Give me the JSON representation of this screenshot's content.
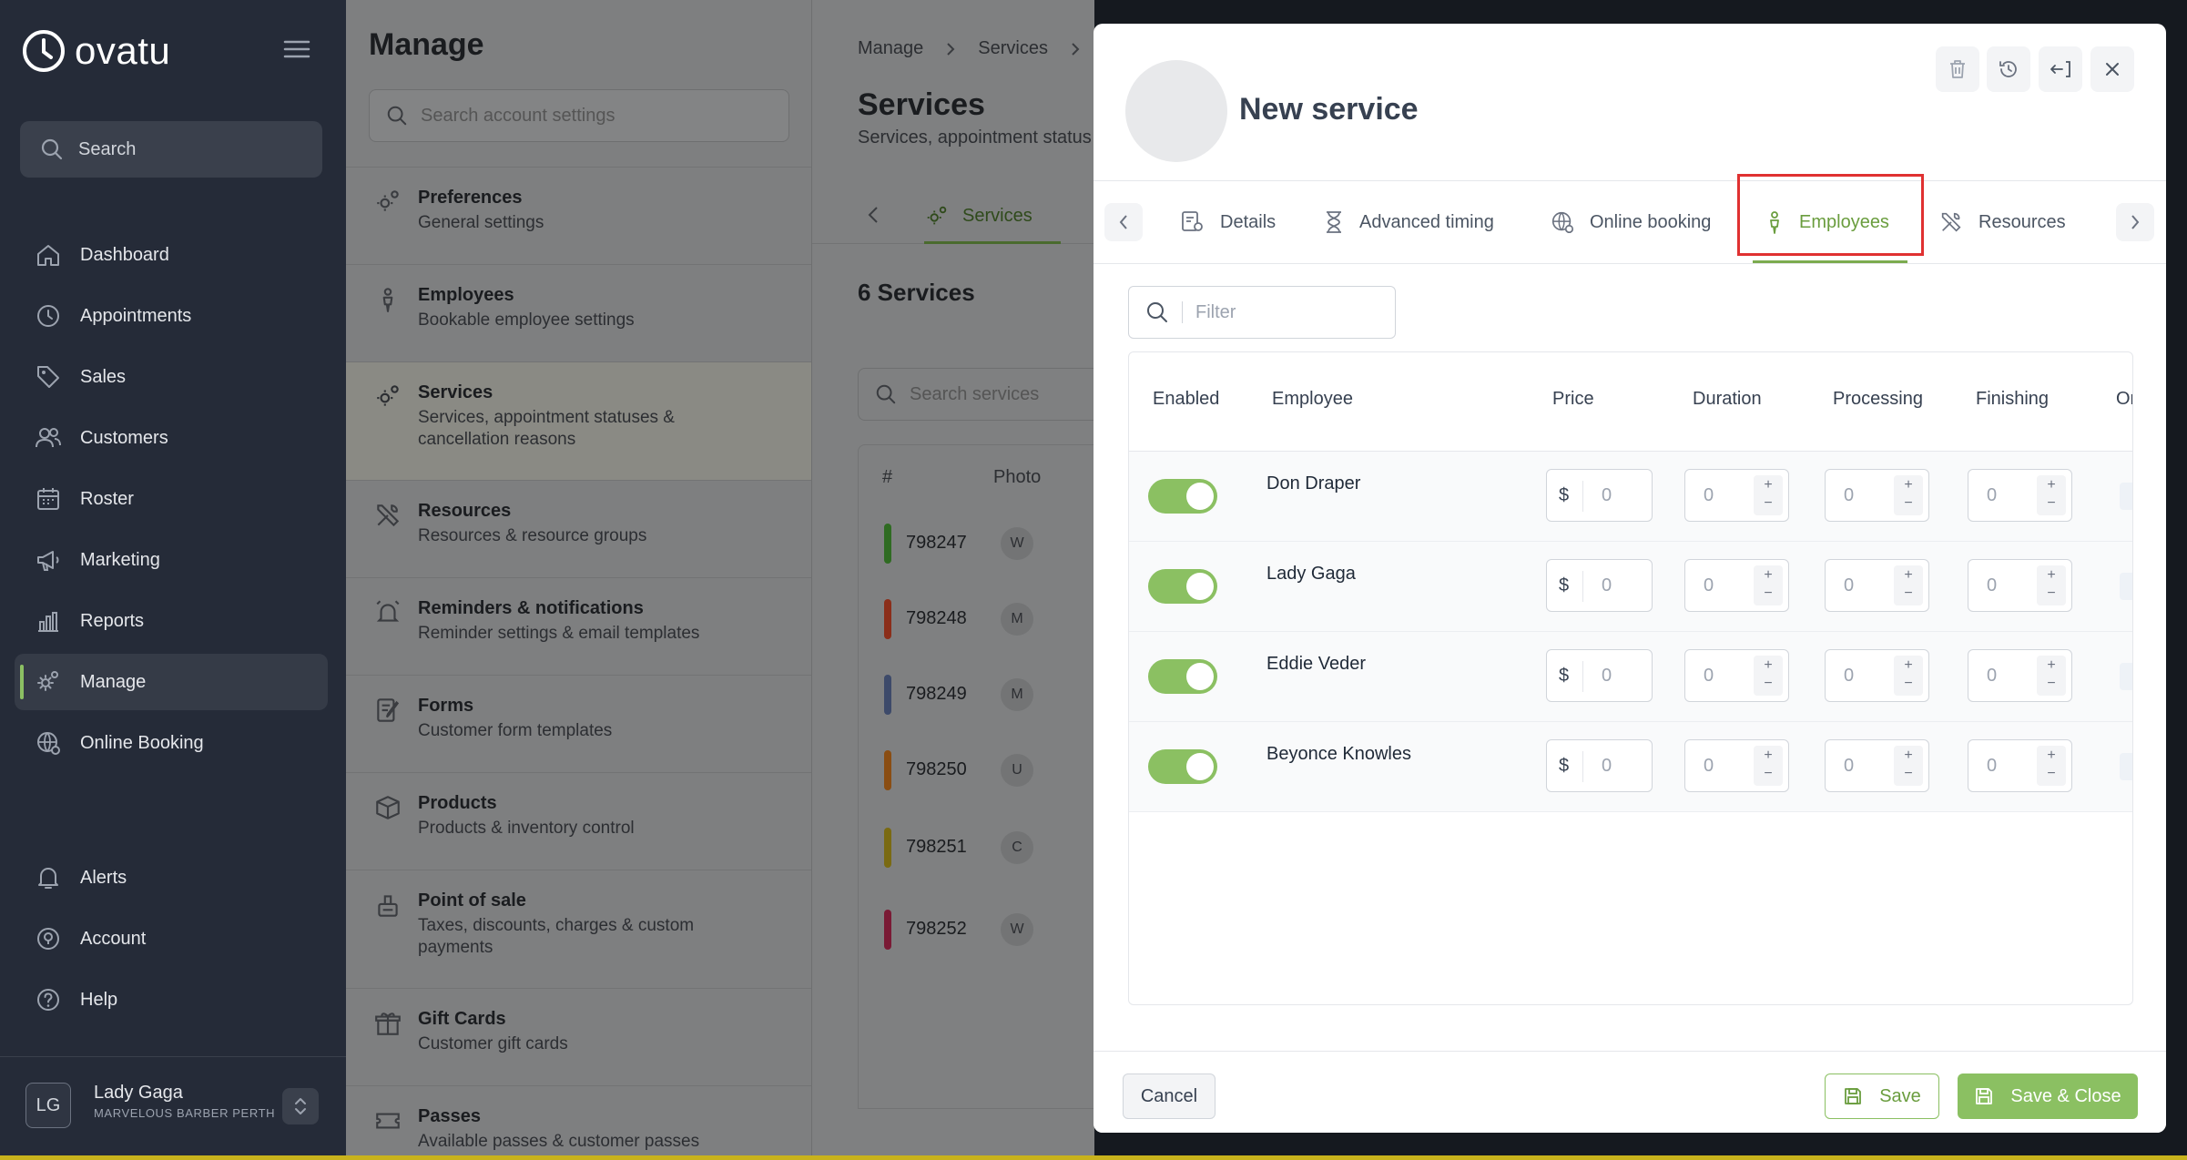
{
  "app": {
    "name": "ovatu"
  },
  "sidebar": {
    "search_label": "Search",
    "items": [
      {
        "label": "Dashboard",
        "icon": "home-icon"
      },
      {
        "label": "Appointments",
        "icon": "clock-icon"
      },
      {
        "label": "Sales",
        "icon": "tag-icon"
      },
      {
        "label": "Customers",
        "icon": "users-icon"
      },
      {
        "label": "Roster",
        "icon": "calendar-icon"
      },
      {
        "label": "Marketing",
        "icon": "megaphone-icon"
      },
      {
        "label": "Reports",
        "icon": "bar-chart-icon"
      },
      {
        "label": "Manage",
        "icon": "gear-icon",
        "active": true
      },
      {
        "label": "Online Booking",
        "icon": "globe-gear-icon"
      },
      {
        "label": "Alerts",
        "icon": "bell-icon"
      },
      {
        "label": "Account",
        "icon": "account-icon"
      },
      {
        "label": "Help",
        "icon": "help-icon"
      }
    ],
    "user": {
      "initials": "LG",
      "name": "Lady Gaga",
      "org": "MARVELOUS BARBER PERTH"
    }
  },
  "manage": {
    "title": "Manage",
    "search_placeholder": "Search account settings",
    "items": [
      {
        "title": "Preferences",
        "subtitle": "General settings"
      },
      {
        "title": "Employees",
        "subtitle": "Bookable employee settings"
      },
      {
        "title": "Services",
        "subtitle": "Services, appointment statuses & cancellation reasons",
        "active": true
      },
      {
        "title": "Resources",
        "subtitle": "Resources & resource groups"
      },
      {
        "title": "Reminders & notifications",
        "subtitle": "Reminder settings & email templates"
      },
      {
        "title": "Forms",
        "subtitle": "Customer form templates"
      },
      {
        "title": "Products",
        "subtitle": "Products & inventory control"
      },
      {
        "title": "Point of sale",
        "subtitle": "Taxes, discounts, charges & custom payments"
      },
      {
        "title": "Gift Cards",
        "subtitle": "Customer gift cards"
      },
      {
        "title": "Passes",
        "subtitle": "Available passes & customer passes"
      }
    ]
  },
  "services_page": {
    "breadcrumb": [
      "Manage",
      "Services"
    ],
    "title": "Services",
    "subtitle": "Services, appointment status",
    "tab_label": "Services",
    "count_label": "6 Services",
    "search_placeholder": "Search services",
    "columns": [
      "#",
      "Photo"
    ],
    "rows": [
      {
        "id": "798247",
        "photo": "W",
        "color": "#2f6b22"
      },
      {
        "id": "798248",
        "photo": "M",
        "color": "#8b2e1a"
      },
      {
        "id": "798249",
        "photo": "M",
        "color": "#3d4a6a"
      },
      {
        "id": "798250",
        "photo": "U",
        "color": "#8a4d12"
      },
      {
        "id": "798251",
        "photo": "C",
        "color": "#7a6a12"
      },
      {
        "id": "798252",
        "photo": "W",
        "color": "#7a1a35"
      }
    ]
  },
  "modal": {
    "title": "New service",
    "tabs": [
      {
        "label": "Details",
        "icon": "details-icon"
      },
      {
        "label": "Advanced timing",
        "icon": "hourglass-icon"
      },
      {
        "label": "Online booking",
        "icon": "globe-gear-icon"
      },
      {
        "label": "Employees",
        "icon": "person-icon",
        "active": true
      },
      {
        "label": "Resources",
        "icon": "tools-icon"
      }
    ],
    "filter_placeholder": "Filter",
    "columns": [
      "Enabled",
      "Employee",
      "Price",
      "Duration",
      "Processing",
      "Finishing",
      "Or"
    ],
    "currency_symbol": "$",
    "employees": [
      {
        "name": "Don Draper",
        "enabled": true,
        "price": "0",
        "duration": "0",
        "processing": "0",
        "finishing": "0"
      },
      {
        "name": "Lady Gaga",
        "enabled": true,
        "price": "0",
        "duration": "0",
        "processing": "0",
        "finishing": "0"
      },
      {
        "name": "Eddie Veder",
        "enabled": true,
        "price": "0",
        "duration": "0",
        "processing": "0",
        "finishing": "0"
      },
      {
        "name": "Beyonce Knowles",
        "enabled": true,
        "price": "0",
        "duration": "0",
        "processing": "0",
        "finishing": "0"
      }
    ],
    "stepper_plus": "+",
    "stepper_minus": "−",
    "footer": {
      "cancel": "Cancel",
      "save": "Save",
      "save_close": "Save & Close"
    }
  },
  "colors": {
    "accent": "#8bc062",
    "accent_text": "#6a9d3e",
    "nav_bg": "#252b38",
    "highlight": "#e03131"
  }
}
